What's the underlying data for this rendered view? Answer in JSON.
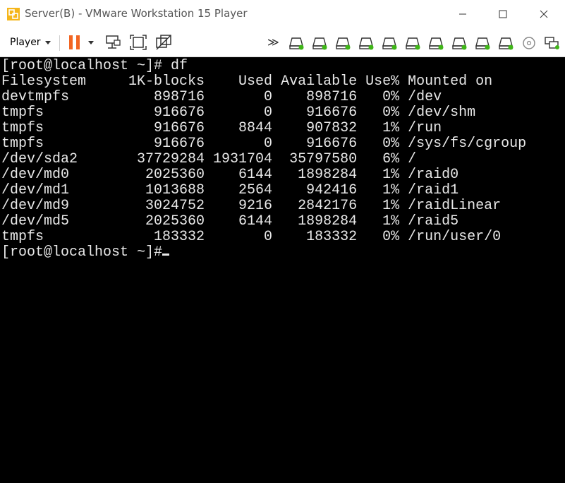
{
  "window": {
    "title": "Server(B) - VMware Workstation 15 Player"
  },
  "toolbar": {
    "player_label": "Player",
    "icons": [
      "pause-icon",
      "send-ctrl-alt-del-icon",
      "fit-guest-icon",
      "unity-icon",
      "more-devices-icon",
      "hard-disk-icon",
      "cd-icon",
      "usb-icon"
    ]
  },
  "terminal": {
    "lines": [
      "[root@localhost ~]# df",
      "Filesystem     1K-blocks    Used Available Use% Mounted on",
      "devtmpfs          898716       0    898716   0% /dev",
      "tmpfs             916676       0    916676   0% /dev/shm",
      "tmpfs             916676    8844    907832   1% /run",
      "tmpfs             916676       0    916676   0% /sys/fs/cgroup",
      "/dev/sda2       37729284 1931704  35797580   6% /",
      "/dev/md0         2025360    6144   1898284   1% /raid0",
      "/dev/md1         1013688    2564    942416   1% /raid1",
      "/dev/md9         3024752    9216   2842176   1% /raidLinear",
      "/dev/md5         2025360    6144   1898284   1% /raid5",
      "tmpfs             183332       0    183332   0% /run/user/0",
      "[root@localhost ~]#"
    ]
  },
  "colors": {
    "pause_accent": "#f26522",
    "device_green": "#3fb618",
    "terminal_text": "#e8e8e8",
    "terminal_bg": "#000000"
  }
}
